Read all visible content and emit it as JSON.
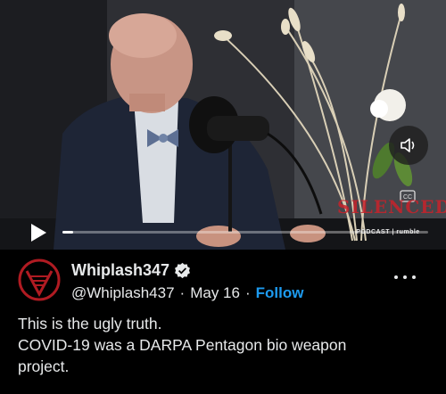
{
  "video": {
    "play_icon": "play-icon",
    "volume_icon": "speaker-icon",
    "captions_icon": "closed-captions-icon",
    "progress_fraction": 0.03,
    "watermark_title": "SILENCED",
    "watermark_sub": "PODCAST | rumble"
  },
  "post": {
    "display_name": "Whiplash347",
    "verified_icon": "verified-badge-icon",
    "handle": "@Whiplash437",
    "date": "May 16",
    "separator": "·",
    "follow_label": "Follow",
    "more_icon": "more-options-icon",
    "text_lines": [
      "This is the ugly truth.",
      "COVID-19 was a DARPA Pentagon bio weapon",
      "project."
    ]
  },
  "colors": {
    "accent": "#1d9bf0",
    "background": "#000000",
    "text": "#e7e9ea",
    "watermark": "#c8222a"
  }
}
